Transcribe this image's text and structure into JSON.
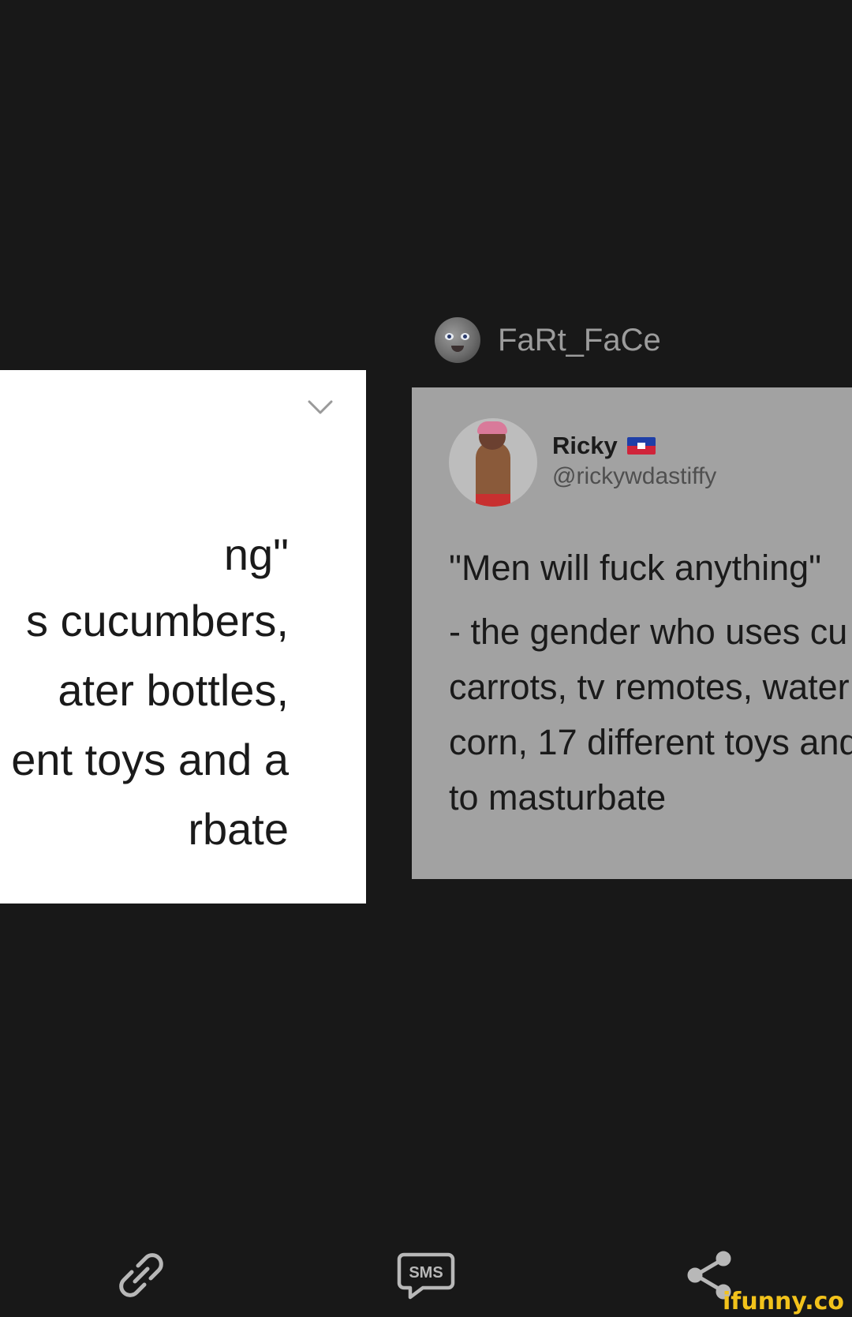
{
  "poster": {
    "username": "FaRt_FaCe",
    "avatar_icon": "alien-face-avatar"
  },
  "left_card": {
    "lines": [
      "ng\"",
      "s cucumbers,",
      "ater bottles,",
      "ent toys and a",
      "rbate"
    ],
    "chevron_icon": "chevron-down-icon"
  },
  "tweet": {
    "display_name": "Ricky",
    "flag_icon": "haiti-flag-icon",
    "handle": "@rickywdastiffy",
    "quote": "\"Men will fuck anything\"",
    "body_lines": [
      "- the gender who uses cu",
      "carrots, tv remotes, water",
      "corn, 17 different toys and",
      "to masturbate"
    ]
  },
  "actions": {
    "link_icon": "link-icon",
    "sms_label": "SMS",
    "share_icon": "share-icon"
  },
  "watermark": "ifunny.co",
  "colors": {
    "background": "#181818",
    "tweet_card": "#a2a2a2",
    "left_card": "#ffffff",
    "watermark": "#f2c21b",
    "icon_gray": "#b8b8b8"
  }
}
